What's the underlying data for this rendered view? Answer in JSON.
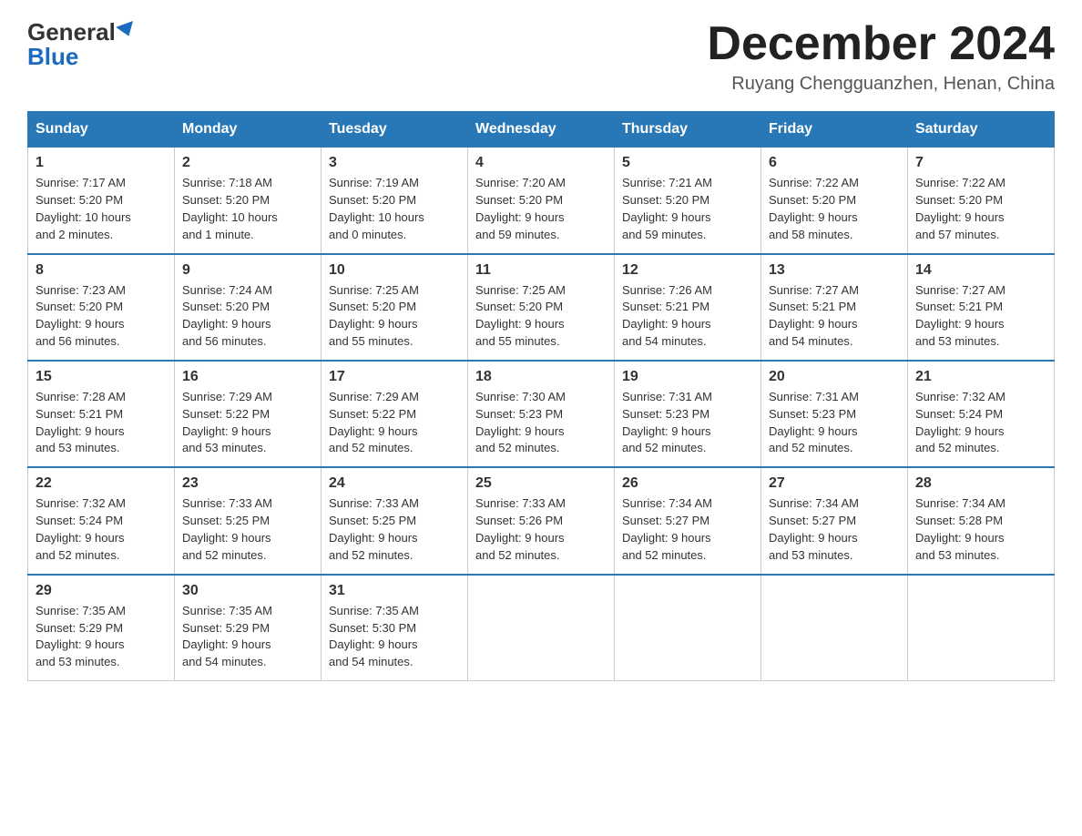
{
  "header": {
    "logo": {
      "general": "General",
      "blue": "Blue"
    },
    "title": "December 2024",
    "subtitle": "Ruyang Chengguanzhen, Henan, China"
  },
  "days_of_week": [
    "Sunday",
    "Monday",
    "Tuesday",
    "Wednesday",
    "Thursday",
    "Friday",
    "Saturday"
  ],
  "weeks": [
    [
      {
        "day": "1",
        "sunrise": "7:17 AM",
        "sunset": "5:20 PM",
        "daylight": "10 hours and 2 minutes."
      },
      {
        "day": "2",
        "sunrise": "7:18 AM",
        "sunset": "5:20 PM",
        "daylight": "10 hours and 1 minute."
      },
      {
        "day": "3",
        "sunrise": "7:19 AM",
        "sunset": "5:20 PM",
        "daylight": "10 hours and 0 minutes."
      },
      {
        "day": "4",
        "sunrise": "7:20 AM",
        "sunset": "5:20 PM",
        "daylight": "9 hours and 59 minutes."
      },
      {
        "day": "5",
        "sunrise": "7:21 AM",
        "sunset": "5:20 PM",
        "daylight": "9 hours and 59 minutes."
      },
      {
        "day": "6",
        "sunrise": "7:22 AM",
        "sunset": "5:20 PM",
        "daylight": "9 hours and 58 minutes."
      },
      {
        "day": "7",
        "sunrise": "7:22 AM",
        "sunset": "5:20 PM",
        "daylight": "9 hours and 57 minutes."
      }
    ],
    [
      {
        "day": "8",
        "sunrise": "7:23 AM",
        "sunset": "5:20 PM",
        "daylight": "9 hours and 56 minutes."
      },
      {
        "day": "9",
        "sunrise": "7:24 AM",
        "sunset": "5:20 PM",
        "daylight": "9 hours and 56 minutes."
      },
      {
        "day": "10",
        "sunrise": "7:25 AM",
        "sunset": "5:20 PM",
        "daylight": "9 hours and 55 minutes."
      },
      {
        "day": "11",
        "sunrise": "7:25 AM",
        "sunset": "5:20 PM",
        "daylight": "9 hours and 55 minutes."
      },
      {
        "day": "12",
        "sunrise": "7:26 AM",
        "sunset": "5:21 PM",
        "daylight": "9 hours and 54 minutes."
      },
      {
        "day": "13",
        "sunrise": "7:27 AM",
        "sunset": "5:21 PM",
        "daylight": "9 hours and 54 minutes."
      },
      {
        "day": "14",
        "sunrise": "7:27 AM",
        "sunset": "5:21 PM",
        "daylight": "9 hours and 53 minutes."
      }
    ],
    [
      {
        "day": "15",
        "sunrise": "7:28 AM",
        "sunset": "5:21 PM",
        "daylight": "9 hours and 53 minutes."
      },
      {
        "day": "16",
        "sunrise": "7:29 AM",
        "sunset": "5:22 PM",
        "daylight": "9 hours and 53 minutes."
      },
      {
        "day": "17",
        "sunrise": "7:29 AM",
        "sunset": "5:22 PM",
        "daylight": "9 hours and 52 minutes."
      },
      {
        "day": "18",
        "sunrise": "7:30 AM",
        "sunset": "5:23 PM",
        "daylight": "9 hours and 52 minutes."
      },
      {
        "day": "19",
        "sunrise": "7:31 AM",
        "sunset": "5:23 PM",
        "daylight": "9 hours and 52 minutes."
      },
      {
        "day": "20",
        "sunrise": "7:31 AM",
        "sunset": "5:23 PM",
        "daylight": "9 hours and 52 minutes."
      },
      {
        "day": "21",
        "sunrise": "7:32 AM",
        "sunset": "5:24 PM",
        "daylight": "9 hours and 52 minutes."
      }
    ],
    [
      {
        "day": "22",
        "sunrise": "7:32 AM",
        "sunset": "5:24 PM",
        "daylight": "9 hours and 52 minutes."
      },
      {
        "day": "23",
        "sunrise": "7:33 AM",
        "sunset": "5:25 PM",
        "daylight": "9 hours and 52 minutes."
      },
      {
        "day": "24",
        "sunrise": "7:33 AM",
        "sunset": "5:25 PM",
        "daylight": "9 hours and 52 minutes."
      },
      {
        "day": "25",
        "sunrise": "7:33 AM",
        "sunset": "5:26 PM",
        "daylight": "9 hours and 52 minutes."
      },
      {
        "day": "26",
        "sunrise": "7:34 AM",
        "sunset": "5:27 PM",
        "daylight": "9 hours and 52 minutes."
      },
      {
        "day": "27",
        "sunrise": "7:34 AM",
        "sunset": "5:27 PM",
        "daylight": "9 hours and 53 minutes."
      },
      {
        "day": "28",
        "sunrise": "7:34 AM",
        "sunset": "5:28 PM",
        "daylight": "9 hours and 53 minutes."
      }
    ],
    [
      {
        "day": "29",
        "sunrise": "7:35 AM",
        "sunset": "5:29 PM",
        "daylight": "9 hours and 53 minutes."
      },
      {
        "day": "30",
        "sunrise": "7:35 AM",
        "sunset": "5:29 PM",
        "daylight": "9 hours and 54 minutes."
      },
      {
        "day": "31",
        "sunrise": "7:35 AM",
        "sunset": "5:30 PM",
        "daylight": "9 hours and 54 minutes."
      },
      null,
      null,
      null,
      null
    ]
  ],
  "labels": {
    "sunrise": "Sunrise:",
    "sunset": "Sunset:",
    "daylight": "Daylight:"
  }
}
